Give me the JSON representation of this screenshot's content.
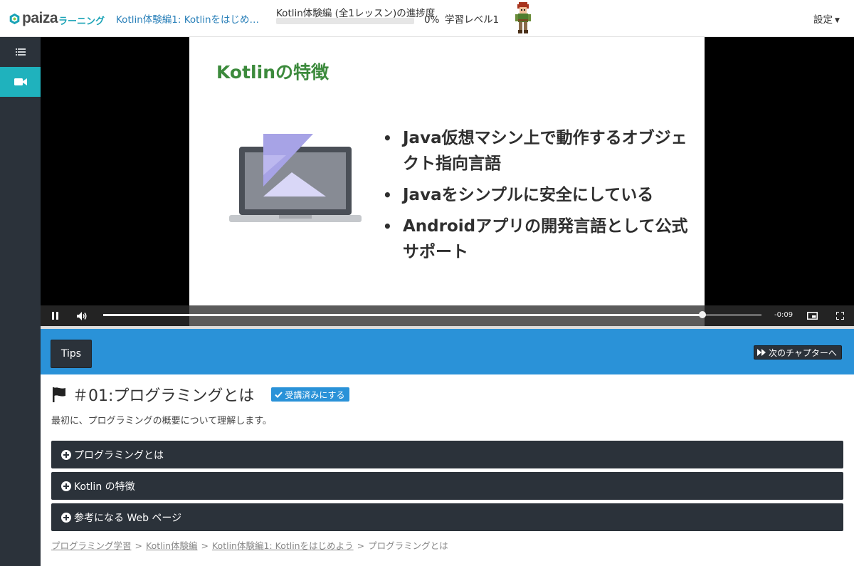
{
  "header": {
    "logo_text": "paiza",
    "logo_sub": "ラーニング",
    "course_link": "Kotlin体験編1: Kotlinをはじめ…",
    "progress_title": "Kotlin体験編 (全1レッスン)の進捗度",
    "progress_percent_text": "0%",
    "progress_value": 0,
    "level_text": "学習レベル1",
    "settings_label": "設定"
  },
  "sidebar": {
    "items": [
      {
        "icon": "list-icon",
        "active": false
      },
      {
        "icon": "video-camera-icon",
        "active": true
      }
    ]
  },
  "video": {
    "slide_title": "Kotlinの特徴",
    "bullets": [
      "Java仮想マシン上で動作するオブジェクト指向言語",
      "Javaをシンプルに安全にしている",
      "Androidアプリの開発言語として公式サポート"
    ],
    "remaining_time": "-0:09",
    "playback_progress": 0.91,
    "colors": {
      "title_green": "#3c8a3c"
    }
  },
  "tabbar": {
    "tips_label": "Tips",
    "next_chapter_label": "次のチャプターへ"
  },
  "chapter": {
    "title": "＃01:プログラミングとは",
    "complete_label": "受講済みにする",
    "intro": "最初に、プログラミングの概要について理解します。"
  },
  "accordions": [
    {
      "label": "プログラミングとは"
    },
    {
      "label": "Kotlin の特徴"
    },
    {
      "label": "参考になる Web ページ"
    }
  ],
  "breadcrumb": {
    "items": [
      "プログラミング学習",
      "Kotlin体験編",
      "Kotlin体験編1: Kotlinをはじめよう"
    ],
    "current": "プログラミングとは",
    "separator": ">"
  },
  "colors": {
    "brand_teal": "#1fb2bd",
    "tab_blue": "#2a92d8",
    "dark": "#2b323a"
  }
}
